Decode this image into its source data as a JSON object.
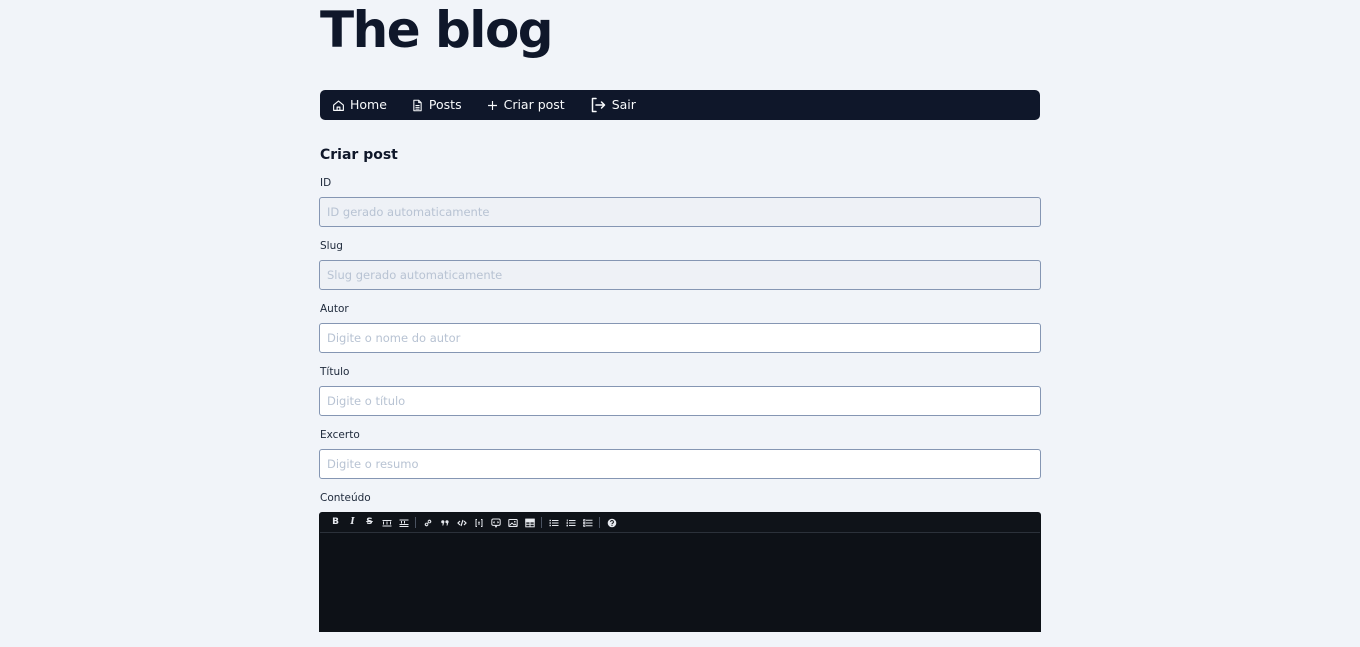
{
  "site_title": "The blog",
  "nav": {
    "home": "Home",
    "posts": "Posts",
    "create_post": "Criar post",
    "logout": "Sair"
  },
  "page_heading": "Criar post",
  "form": {
    "id": {
      "label": "ID",
      "placeholder": "ID gerado automaticamente"
    },
    "slug": {
      "label": "Slug",
      "placeholder": "Slug gerado automaticamente"
    },
    "author": {
      "label": "Autor",
      "placeholder": "Digite o nome do autor"
    },
    "title": {
      "label": "Título",
      "placeholder": "Digite o título"
    },
    "excerpt": {
      "label": "Excerto",
      "placeholder": "Digite o resumo"
    },
    "content": {
      "label": "Conteúdo"
    }
  },
  "editor_toolbar": {
    "bold": "B",
    "italic": "I",
    "strikethrough": "S",
    "icons": [
      "bold-icon",
      "italic-icon",
      "strikethrough-icon",
      "heading-icon",
      "title-icon",
      "link-icon",
      "quote-icon",
      "code-icon",
      "code-block-icon",
      "comment-icon",
      "image-icon",
      "table-icon",
      "unordered-list-icon",
      "ordered-list-icon",
      "checklist-icon",
      "help-icon"
    ]
  },
  "colors": {
    "background": "#f1f4f9",
    "nav_background": "#0f172a",
    "editor_background": "#0d1117",
    "input_border": "#8596b3"
  }
}
